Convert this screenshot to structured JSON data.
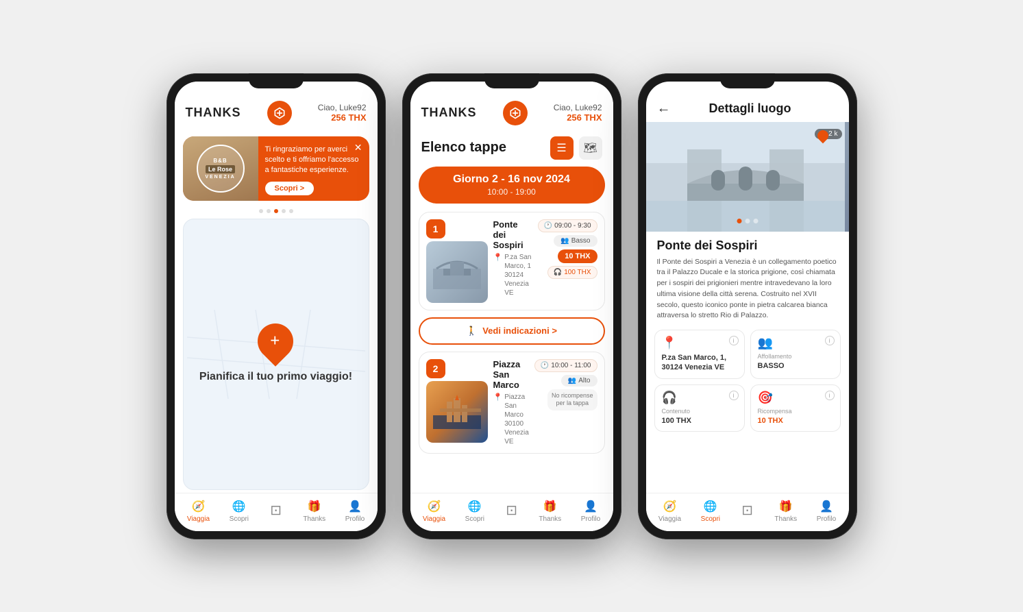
{
  "app": {
    "logo": "THANKS",
    "user": "Ciao, Luke92",
    "balance": "256 THX"
  },
  "nav": {
    "items": [
      {
        "id": "viaggia",
        "label": "Viaggia",
        "icon": "🧭"
      },
      {
        "id": "scopri",
        "label": "Scopri",
        "icon": "🌐"
      },
      {
        "id": "scan",
        "label": "",
        "icon": "⊡"
      },
      {
        "id": "thanks",
        "label": "Thanks",
        "icon": "🎁"
      },
      {
        "id": "profilo",
        "label": "Profilo",
        "icon": "👤"
      }
    ]
  },
  "phone1": {
    "promo": {
      "hotel_line1": "B&B",
      "hotel_line2": "Le Rose",
      "hotel_city": "VENEZIA",
      "text": "Ti ringraziamo per averci scelto e ti offriamo l'accesso a fantastiche esperienze.",
      "cta": "Scopri >"
    },
    "map_caption": "Pianifica il tuo primo viaggio!",
    "active_nav": "viaggia"
  },
  "phone2": {
    "section_title": "Elenco tappe",
    "day": {
      "label": "Giorno 2 - 16 nov 2024",
      "time": "10:00 - 19:00"
    },
    "stops": [
      {
        "num": "1",
        "time": "09:00 - 9:30",
        "crowd": "Basso",
        "thx": "10 THX",
        "audio": "100 THX",
        "name": "Ponte dei Sospiri",
        "address": "P.za San Marco, 1\n30124 Venezia VE",
        "directions": "Vedi indicazioni >"
      },
      {
        "num": "2",
        "time": "10:00 - 11:00",
        "crowd": "Alto",
        "badge": "No ricompense\nper la tappa",
        "name": "Piazza San Marco",
        "address": "Piazza San Marco\n30100 Venezia VE"
      }
    ],
    "active_nav": "viaggia"
  },
  "phone3": {
    "back": "←",
    "title": "Dettagli luogo",
    "distance": "10,2 k",
    "place_name": "Ponte dei Sospiri",
    "description": "Il Ponte dei Sospiri a Venezia è un collegamento poetico tra il Palazzo Ducale e la storica prigione, così chiamata per i sospiri dei prigionieri mentre intravedevano la loro ultima visione della città serena. Costruito nel XVII secolo, questo iconico ponte in pietra calcarea bianca attraversa lo stretto Rio di Palazzo.",
    "details": [
      {
        "icon": "📍",
        "label": "",
        "value": "P.za San Marco, 1,\n30124 Venezia VE"
      },
      {
        "icon": "👥",
        "label": "Affollamento",
        "value": "BASSO",
        "orange": false
      },
      {
        "icon": "🎧",
        "label": "Contenuto",
        "value": "100 THX",
        "orange": false
      },
      {
        "icon": "🎯",
        "label": "Ricompensa",
        "value": "10 THX",
        "orange": true
      }
    ],
    "active_nav": "scopri"
  }
}
